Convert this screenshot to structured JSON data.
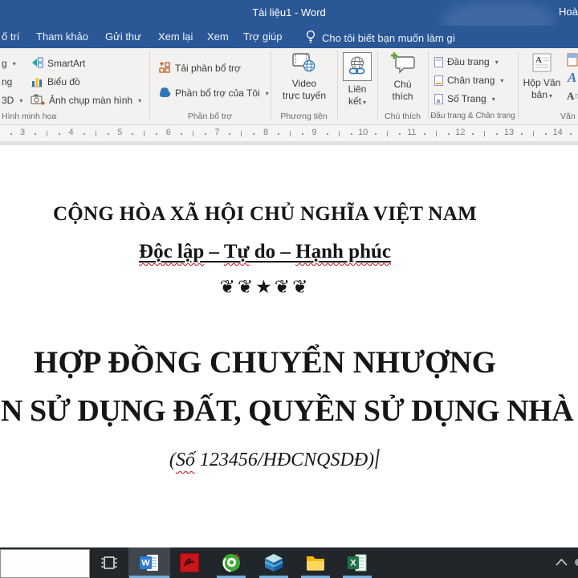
{
  "titlebar": {
    "title": "Tài liệu1 - Word",
    "account": "Hoà"
  },
  "tabs": {
    "items": [
      {
        "label": "ố trí"
      },
      {
        "label": "Tham khảo"
      },
      {
        "label": "Gửi thư"
      },
      {
        "label": "Xem lại"
      },
      {
        "label": "Xem"
      },
      {
        "label": "Trợ giúp"
      }
    ],
    "tellme": "Cho tôi biết bạn muốn làm gì"
  },
  "ribbon": {
    "clipped": {
      "row1": "g",
      "row2": "ng",
      "row3": "3D"
    },
    "illustrations": {
      "smartart": "SmartArt",
      "chart": "Biểu đồ",
      "screenshot": "Ảnh chụp màn hình",
      "group": "Hình minh họa"
    },
    "addins": {
      "get": "Tải phần bổ trợ",
      "mine": "Phần bổ trợ của Tôi",
      "group": "Phần bổ trợ"
    },
    "media": {
      "video_line1": "Video",
      "video_line2": "trực tuyến",
      "group": "Phương tiện"
    },
    "links": {
      "line1": "Liên",
      "line2": "kết"
    },
    "comments": {
      "line1": "Chú",
      "line2": "thích",
      "group": "Chú thích"
    },
    "header_footer": {
      "header": "Đầu trang",
      "footer": "Chân trang",
      "page_number": "Số Trang",
      "group": "Đầu trang & Chân trang"
    },
    "textgroup": {
      "line1": "Hộp Văn",
      "line2": "bản",
      "group": "Văn bả"
    }
  },
  "ruler": {
    "numbers": [
      3,
      4,
      5,
      6,
      7,
      8,
      9,
      10,
      11,
      12,
      13,
      14
    ]
  },
  "document": {
    "line1": "CỘNG HÒA XÃ HỘI CHỦ NGHĨA VIỆT NAM",
    "motto_segments": [
      {
        "text": "Độc lập",
        "misspelled": true
      },
      {
        "text": " – ",
        "misspelled": false
      },
      {
        "text": "Tự",
        "misspelled": true
      },
      {
        "text": " do – ",
        "misspelled": false
      },
      {
        "text": "Hạnh phúc",
        "misspelled": true
      }
    ],
    "ornament": "❦❦★❦❦",
    "heading1": "HỢP ĐỒNG CHUYỂN NHƯỢNG",
    "heading2": "N SỬ DỤNG ĐẤT, QUYỀN SỬ DỤNG NHÀ",
    "subtitle_segments": [
      {
        "text": "(",
        "misspelled": false
      },
      {
        "text": "Số",
        "misspelled": true
      },
      {
        "text": " 123456/HĐCNQSDĐ)",
        "misspelled": false
      }
    ]
  },
  "taskbar": {
    "apps": [
      {
        "name": "task-view",
        "type": "taskview",
        "running": false,
        "active": false
      },
      {
        "name": "word",
        "type": "word",
        "running": true,
        "active": true
      },
      {
        "name": "red-app",
        "type": "redapp",
        "running": false,
        "active": false
      },
      {
        "name": "coccoc-browser",
        "type": "coccoc",
        "running": true,
        "active": false
      },
      {
        "name": "cube-app",
        "type": "cube",
        "running": true,
        "active": false
      },
      {
        "name": "file-explorer",
        "type": "folder",
        "running": true,
        "active": false
      },
      {
        "name": "excel",
        "type": "excel",
        "running": true,
        "active": false
      }
    ]
  },
  "colors": {
    "accent_blue": "#2b5797",
    "taskbar_underline": "#6cb3e3",
    "spellcheck_red": "#cc1111"
  }
}
